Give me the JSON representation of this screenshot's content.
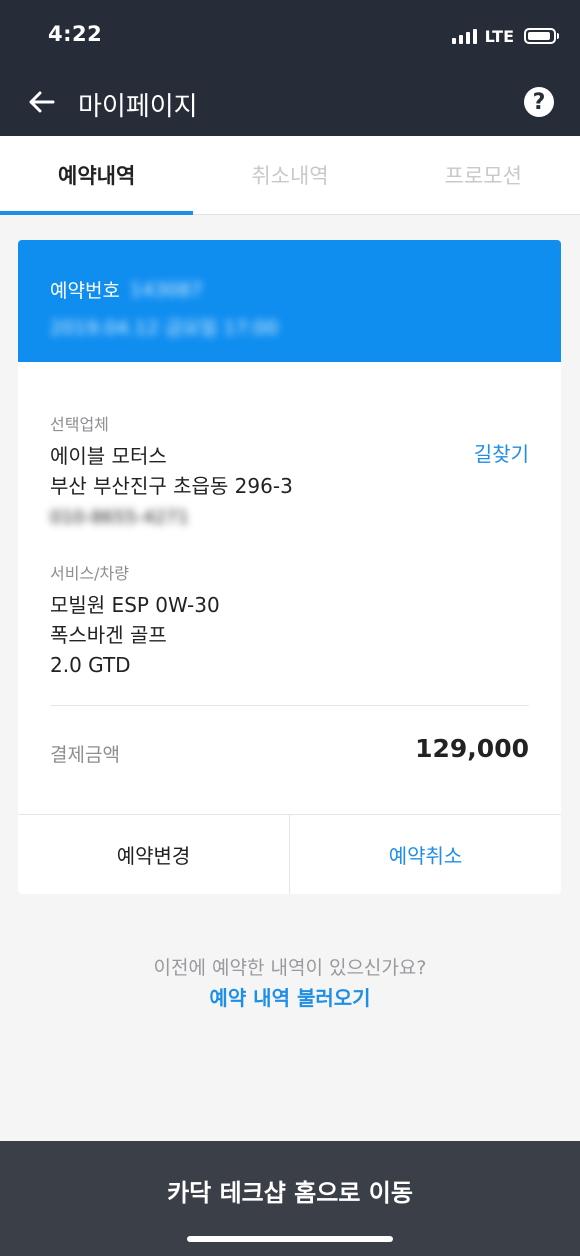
{
  "status_bar": {
    "time": "4:22",
    "network": "LTE",
    "battery_fill": 0.85
  },
  "header": {
    "title": "마이페이지",
    "help_icon": "?"
  },
  "tabs": [
    {
      "label": "예약내역",
      "active": true
    },
    {
      "label": "취소내역",
      "active": false
    },
    {
      "label": "프로모션",
      "active": false
    }
  ],
  "reservation": {
    "number_label": "예약번호",
    "number_value": "143087",
    "datetime": "2019.04.12 금요일 17:00",
    "shop_label": "선택업체",
    "shop_name": "에이블 모터스",
    "shop_address": "부산 부산진구 초읍동 296-3",
    "shop_phone": "010-8655-4271",
    "find_way": "길찾기",
    "service_label": "서비스/차량",
    "service_lines": [
      "모빌원 ESP 0W-30",
      "폭스바겐 골프",
      "2.0 GTD"
    ],
    "payment_label": "결제금액",
    "payment_value": "129,000",
    "change_button": "예약변경",
    "cancel_button": "예약취소"
  },
  "previous": {
    "question": "이전에 예약한 내역이 있으신가요?",
    "link": "예약 내역 불러오기"
  },
  "bottom": {
    "button": "카닥 테크샵 홈으로 이동"
  },
  "colors": {
    "topbar": "#272c39",
    "accent": "#1f8ee6",
    "card_header": "#108ef0",
    "bottom_bar": "#3b3f48"
  }
}
